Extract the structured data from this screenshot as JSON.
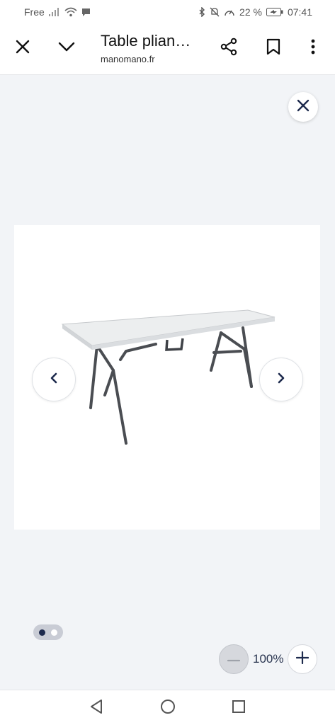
{
  "status_bar": {
    "carrier": "Free",
    "battery_percent": "22 %",
    "time": "07:41",
    "icons": [
      "signal-icon",
      "wifi-icon",
      "chat-bubble-icon",
      "bluetooth-icon",
      "mute-icon",
      "speed-icon",
      "battery-icon"
    ]
  },
  "header": {
    "title": "Table plian…",
    "domain": "manomano.fr",
    "icons": [
      "close-icon",
      "chevron-down-icon",
      "share-icon",
      "bookmark-icon",
      "more-vert-icon"
    ]
  },
  "viewer": {
    "image_description_icon": "folding-table-image",
    "pager": {
      "total": 2,
      "active_index": 0,
      "active_color": "#1d2a4d",
      "inactive_color": "#ffffff"
    },
    "zoom": {
      "level": "100%"
    }
  },
  "colors": {
    "accent_dark": "#1d2a4d",
    "background": "#f2f4f7"
  }
}
